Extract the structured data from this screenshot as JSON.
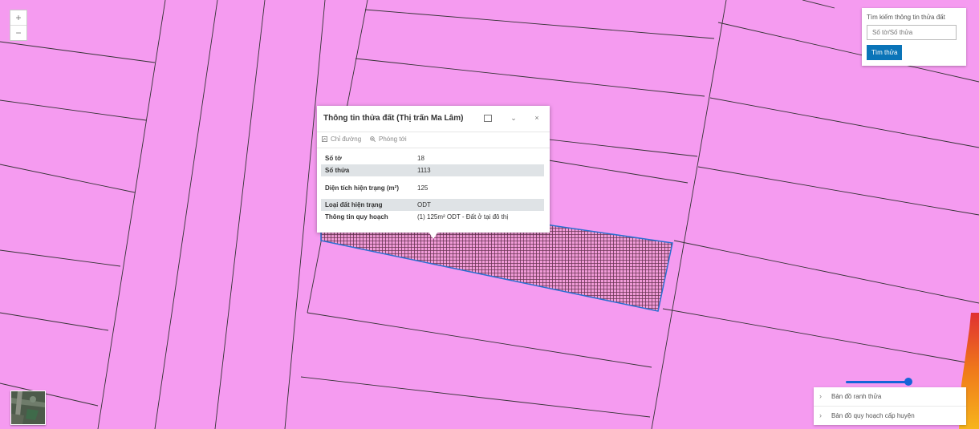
{
  "map": {
    "parcel_fill": "#f59bf0",
    "parcel_line": "#333333",
    "selected_outline": "#2b6fd1"
  },
  "zoom": {
    "in_label": "+",
    "out_label": "−"
  },
  "search": {
    "title": "Tìm kiếm thông tin thửa đất",
    "placeholder": "Số tờ/Số thửa",
    "button_label": "Tìm thửa"
  },
  "popup": {
    "title": "Thông tin thửa đất (Thị trấn Ma Lâm)",
    "actions": {
      "directions_label": "Chỉ đường",
      "zoom_to_label": "Phóng tới"
    },
    "attributes": [
      {
        "key": "Số tờ",
        "value": "18"
      },
      {
        "key": "Số thửa",
        "value": "1113"
      },
      {
        "key": "Diện tích hiện trạng (m²)",
        "value": "125"
      },
      {
        "key": "Loại đất hiện trạng",
        "value": "ODT"
      },
      {
        "key": "Thông tin quy hoạch",
        "value": "(1) 125m² ODT - Đất ở tại đô thị"
      }
    ]
  },
  "opacity_slider": {
    "value": 1.0
  },
  "layers": [
    {
      "label": "Bản đồ ranh thửa"
    },
    {
      "label": "Bản đồ quy hoạch cấp huyện"
    }
  ]
}
